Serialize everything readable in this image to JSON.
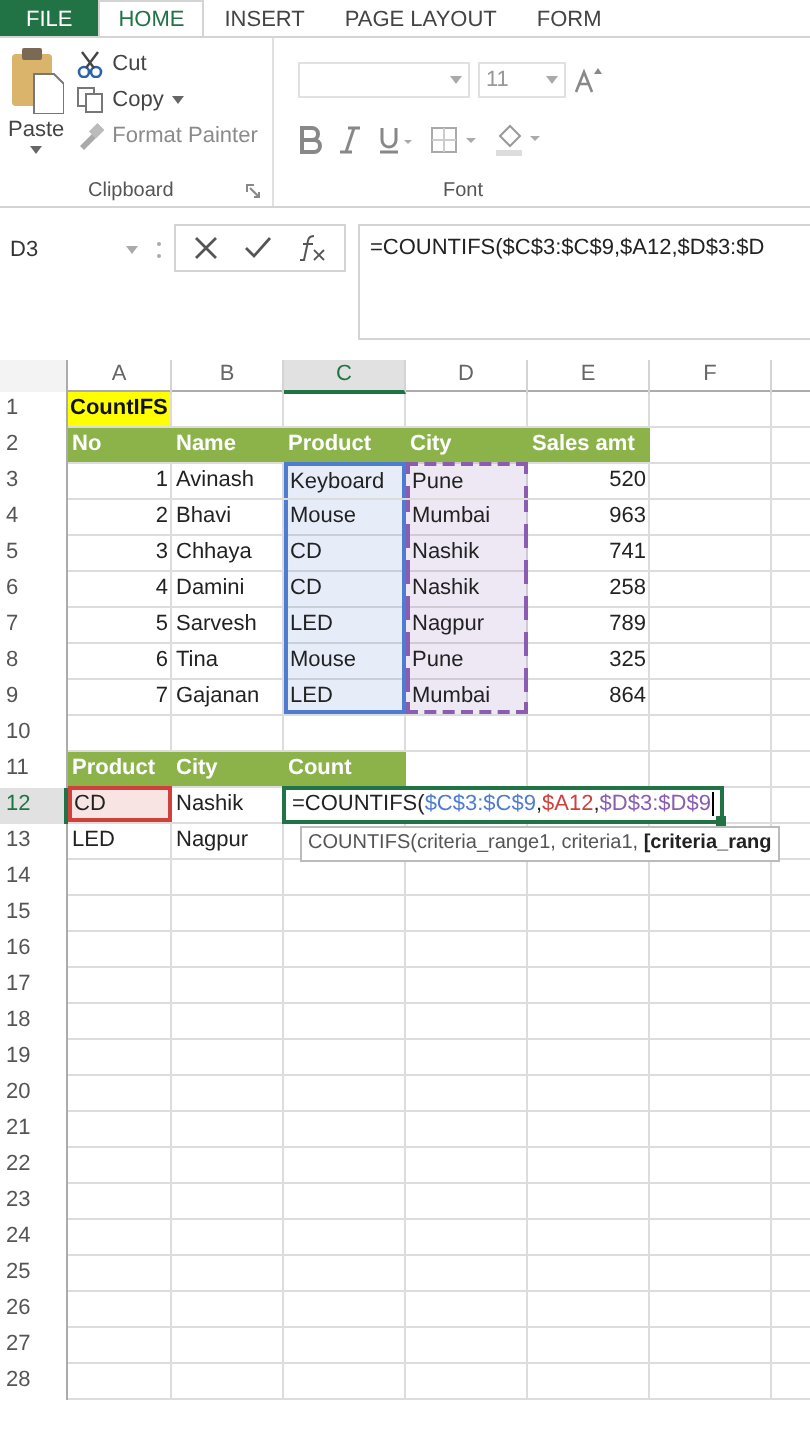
{
  "ribbon": {
    "tabs": [
      {
        "label": "FILE",
        "kind": "file",
        "selected": false
      },
      {
        "label": "HOME",
        "kind": "tab",
        "selected": true
      },
      {
        "label": "INSERT",
        "kind": "tab",
        "selected": false
      },
      {
        "label": "PAGE LAYOUT",
        "kind": "tab",
        "selected": false
      },
      {
        "label": "FORM",
        "kind": "tab",
        "selected": false
      }
    ],
    "clipboard": {
      "label": "Clipboard",
      "paste": "Paste",
      "cut": "Cut",
      "copy": "Copy",
      "format_painter": {
        "label": "Format Painter",
        "disabled": true
      }
    },
    "font": {
      "label": "Font",
      "size": "11"
    }
  },
  "formula_bar": {
    "name_box": "D3",
    "formula": "=COUNTIFS($C$3:$C$9,$A12,$D$3:$D"
  },
  "sheet": {
    "columns": [
      {
        "label": "A",
        "selected": false
      },
      {
        "label": "B",
        "selected": false
      },
      {
        "label": "C",
        "selected": true
      },
      {
        "label": "D",
        "selected": false
      },
      {
        "label": "E",
        "selected": false
      },
      {
        "label": "F",
        "selected": false
      }
    ],
    "rows": [
      {
        "label": "1",
        "selected": false,
        "cells": [
          {
            "kind": "title",
            "text": "CountIFS"
          }
        ]
      },
      {
        "label": "2",
        "selected": false,
        "cells": [
          {
            "kind": "header",
            "text": "No"
          },
          {
            "kind": "header",
            "text": "Name"
          },
          {
            "kind": "header",
            "text": "Product"
          },
          {
            "kind": "header",
            "text": "City"
          },
          {
            "kind": "header",
            "text": "Sales amt"
          }
        ]
      },
      {
        "label": "3",
        "selected": false,
        "cells": [
          {
            "kind": "number",
            "text": "1"
          },
          {
            "kind": "text",
            "text": "Avinash"
          },
          {
            "kind": "text",
            "text": "Keyboard",
            "highlight": {
              "kind": "selection",
              "color": "#4f7bd0"
            }
          },
          {
            "kind": "text",
            "text": "Pune",
            "highlight": {
              "kind": "copy",
              "color": "#8a5db0"
            }
          },
          {
            "kind": "number",
            "text": "520"
          }
        ]
      },
      {
        "label": "4",
        "selected": false,
        "cells": [
          {
            "kind": "number",
            "text": "2"
          },
          {
            "kind": "text",
            "text": "Bhavi"
          },
          {
            "kind": "text",
            "text": "Mouse",
            "highlight": {
              "kind": "selection",
              "color": "#4f7bd0"
            }
          },
          {
            "kind": "text",
            "text": "Mumbai",
            "highlight": {
              "kind": "copy",
              "color": "#8a5db0"
            }
          },
          {
            "kind": "number",
            "text": "963"
          }
        ]
      },
      {
        "label": "5",
        "selected": false,
        "cells": [
          {
            "kind": "number",
            "text": "3"
          },
          {
            "kind": "text",
            "text": "Chhaya"
          },
          {
            "kind": "text",
            "text": "CD",
            "highlight": {
              "kind": "selection",
              "color": "#4f7bd0"
            }
          },
          {
            "kind": "text",
            "text": "Nashik",
            "highlight": {
              "kind": "copy",
              "color": "#8a5db0"
            }
          },
          {
            "kind": "number",
            "text": "741"
          }
        ]
      },
      {
        "label": "6",
        "selected": false,
        "cells": [
          {
            "kind": "number",
            "text": "4"
          },
          {
            "kind": "text",
            "text": "Damini"
          },
          {
            "kind": "text",
            "text": "CD",
            "highlight": {
              "kind": "selection",
              "color": "#4f7bd0"
            }
          },
          {
            "kind": "text",
            "text": "Nashik",
            "highlight": {
              "kind": "copy",
              "color": "#8a5db0"
            }
          },
          {
            "kind": "number",
            "text": "258"
          }
        ]
      },
      {
        "label": "7",
        "selected": false,
        "cells": [
          {
            "kind": "number",
            "text": "5"
          },
          {
            "kind": "text",
            "text": "Sarvesh"
          },
          {
            "kind": "text",
            "text": "LED",
            "highlight": {
              "kind": "selection",
              "color": "#4f7bd0"
            }
          },
          {
            "kind": "text",
            "text": "Nagpur",
            "highlight": {
              "kind": "copy",
              "color": "#8a5db0"
            }
          },
          {
            "kind": "number",
            "text": "789"
          }
        ]
      },
      {
        "label": "8",
        "selected": false,
        "cells": [
          {
            "kind": "number",
            "text": "6"
          },
          {
            "kind": "text",
            "text": "Tina"
          },
          {
            "kind": "text",
            "text": "Mouse",
            "highlight": {
              "kind": "selection",
              "color": "#4f7bd0"
            }
          },
          {
            "kind": "text",
            "text": "Pune",
            "highlight": {
              "kind": "copy",
              "color": "#8a5db0"
            }
          },
          {
            "kind": "number",
            "text": "325"
          }
        ]
      },
      {
        "label": "9",
        "selected": false,
        "cells": [
          {
            "kind": "number",
            "text": "7"
          },
          {
            "kind": "text",
            "text": "Gajanan"
          },
          {
            "kind": "text",
            "text": "LED",
            "highlight": {
              "kind": "selection",
              "color": "#4f7bd0"
            }
          },
          {
            "kind": "text",
            "text": "Mumbai",
            "highlight": {
              "kind": "copy",
              "color": "#8a5db0"
            }
          },
          {
            "kind": "number",
            "text": "864"
          }
        ]
      },
      {
        "label": "10",
        "selected": false
      },
      {
        "label": "11",
        "selected": false,
        "cells": [
          {
            "kind": "header",
            "text": "Product"
          },
          {
            "kind": "header",
            "text": "City"
          },
          {
            "kind": "header",
            "text": "Count"
          }
        ]
      },
      {
        "label": "12",
        "selected": true,
        "cells": [
          {
            "kind": "text",
            "text": "CD",
            "highlight": {
              "kind": "selection",
              "color": "#d0413c"
            }
          },
          {
            "kind": "text",
            "text": "Nashik"
          },
          {
            "kind": "formula",
            "segments": [
              {
                "text": "=COUNTIFS("
              },
              {
                "text": "$C$3:$C$9",
                "color": "#4f7bd0"
              },
              {
                "text": ","
              },
              {
                "text": "$A12",
                "color": "#d0413c"
              },
              {
                "text": ","
              },
              {
                "text": "$D$3:$D$9",
                "color": "#8a5db0"
              }
            ]
          }
        ]
      },
      {
        "label": "13",
        "selected": false,
        "cells": [
          {
            "kind": "text",
            "text": "LED"
          },
          {
            "kind": "text",
            "text": "Nagpur"
          }
        ]
      },
      {
        "label": "14",
        "selected": false
      },
      {
        "label": "15",
        "selected": false
      },
      {
        "label": "16",
        "selected": false
      },
      {
        "label": "17",
        "selected": false
      },
      {
        "label": "18",
        "selected": false
      },
      {
        "label": "19",
        "selected": false
      },
      {
        "label": "20",
        "selected": false
      },
      {
        "label": "21",
        "selected": false
      },
      {
        "label": "22",
        "selected": false
      },
      {
        "label": "23",
        "selected": false
      },
      {
        "label": "24",
        "selected": false
      },
      {
        "label": "25",
        "selected": false
      },
      {
        "label": "26",
        "selected": false
      },
      {
        "label": "27",
        "selected": false
      },
      {
        "label": "28",
        "selected": false
      }
    ],
    "tooltip": "COUNTIFS(criteria_range1, criteria1, **[criteria_rang**"
  }
}
